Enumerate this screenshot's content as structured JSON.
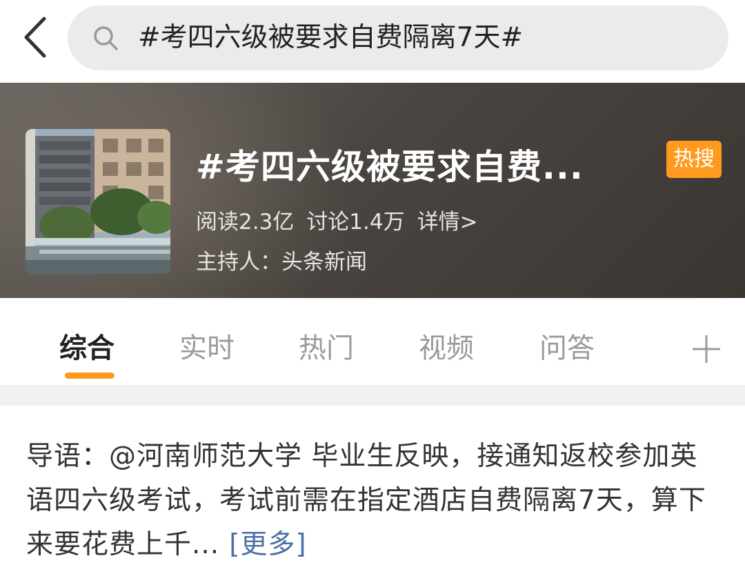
{
  "search": {
    "query": "#考四六级被要求自费隔离7天#"
  },
  "topic": {
    "title": "#考四六级被要求自费...",
    "badge": "热搜",
    "reads": "阅读2.3亿",
    "discussions": "讨论1.4万",
    "detail_link": "详情>",
    "host": "主持人：头条新闻",
    "badge_color": "#ff9a1f"
  },
  "tabs": [
    {
      "label": "综合",
      "active": true
    },
    {
      "label": "实时"
    },
    {
      "label": "热门"
    },
    {
      "label": "视频"
    },
    {
      "label": "问答"
    }
  ],
  "intro": {
    "text": "导语：@河南师范大学 毕业生反映，接通知返校参加英语四六级考试，考试前需在指定酒店自费隔离7天，算下来要花费上千...",
    "more": "[更多]"
  },
  "icons": {
    "back": "chevron-left-icon",
    "search": "search-icon",
    "add_tab": "plus-icon"
  },
  "colors": {
    "accent": "#ff9a1f",
    "link": "#4a6fa5"
  }
}
